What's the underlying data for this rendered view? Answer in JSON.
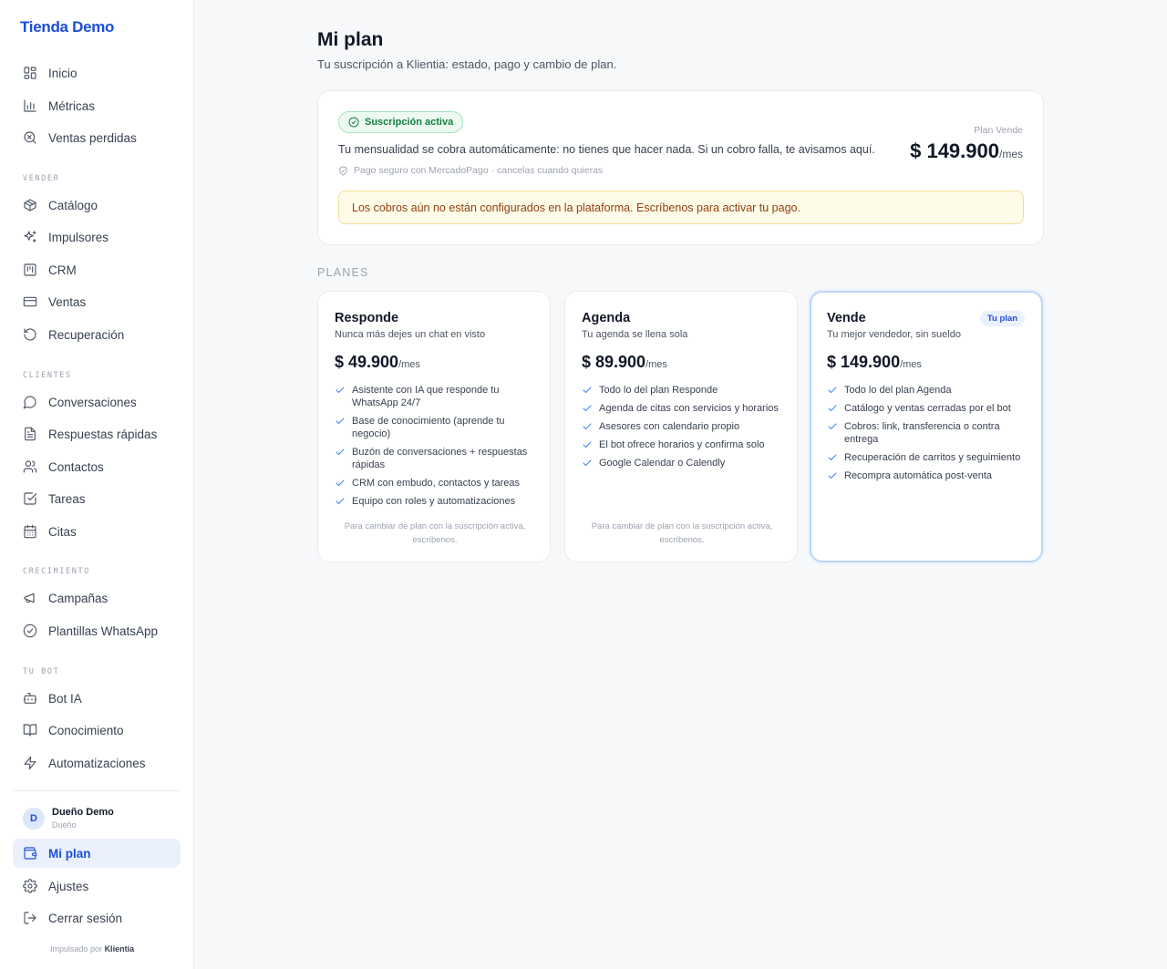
{
  "sidebar": {
    "brand": "Tienda Demo",
    "top_items": [
      {
        "label": "Inicio",
        "icon": "dashboard-icon"
      },
      {
        "label": "Métricas",
        "icon": "bar-chart-icon"
      },
      {
        "label": "Ventas perdidas",
        "icon": "search-x-icon"
      }
    ],
    "sections": [
      {
        "label": "VENDER",
        "items": [
          {
            "label": "Catálogo",
            "icon": "box-icon"
          },
          {
            "label": "Impulsores",
            "icon": "sparkles-icon"
          },
          {
            "label": "CRM",
            "icon": "kanban-icon"
          },
          {
            "label": "Ventas",
            "icon": "credit-card-icon"
          },
          {
            "label": "Recuperación",
            "icon": "rotate-ccw-icon"
          }
        ]
      },
      {
        "label": "CLIENTES",
        "items": [
          {
            "label": "Conversaciones",
            "icon": "chat-bubble-icon"
          },
          {
            "label": "Respuestas rápidas",
            "icon": "file-text-icon"
          },
          {
            "label": "Contactos",
            "icon": "users-icon"
          },
          {
            "label": "Tareas",
            "icon": "check-square-icon"
          },
          {
            "label": "Citas",
            "icon": "calendar-icon"
          }
        ]
      },
      {
        "label": "CRECIMIENTO",
        "items": [
          {
            "label": "Campañas",
            "icon": "megaphone-icon"
          },
          {
            "label": "Plantillas WhatsApp",
            "icon": "check-circle-icon"
          }
        ]
      },
      {
        "label": "TU BOT",
        "items": [
          {
            "label": "Bot IA",
            "icon": "bot-icon"
          },
          {
            "label": "Conocimiento",
            "icon": "book-open-icon"
          },
          {
            "label": "Automatizaciones",
            "icon": "zap-icon"
          }
        ]
      }
    ],
    "user": {
      "initial": "D",
      "name": "Dueño Demo",
      "role": "Dueño"
    },
    "bottom_items": [
      {
        "label": "Mi plan",
        "icon": "wallet-icon",
        "active": true
      },
      {
        "label": "Ajustes",
        "icon": "gear-icon"
      },
      {
        "label": "Cerrar sesión",
        "icon": "logout-icon"
      }
    ],
    "powered_by_prefix": "Impulsado por",
    "powered_by_brand": "Klientia"
  },
  "page": {
    "title": "Mi plan",
    "subtitle": "Tu suscripción a Klientia: estado, pago y cambio de plan."
  },
  "subscription": {
    "status_badge": "Suscripción activa",
    "description": "Tu mensualidad se cobra automáticamente: no tienes que hacer nada. Si un cobro falla, te avisamos aquí.",
    "secure_note": "Pago seguro con MercadoPago · cancelas cuando quieras",
    "plan_label": "Plan Vende",
    "price": "$ 149.900",
    "period": "/mes",
    "warning": "Los cobros aún no están configurados en la plataforma. Escríbenos para activar tu pago."
  },
  "plans_heading": "PLANES",
  "plans": [
    {
      "name": "Responde",
      "tagline": "Nunca más dejes un chat en visto",
      "price": "$ 49.900",
      "period": "/mes",
      "current": false,
      "features": [
        "Asistente con IA que responde tu WhatsApp 24/7",
        "Base de conocimiento (aprende tu negocio)",
        "Buzón de conversaciones + respuestas rápidas",
        "CRM con embudo, contactos y tareas",
        "Equipo con roles y automatizaciones"
      ],
      "note": "Para cambiar de plan con la suscripción activa, escríbenos."
    },
    {
      "name": "Agenda",
      "tagline": "Tu agenda se llena sola",
      "price": "$ 89.900",
      "period": "/mes",
      "current": false,
      "features": [
        "Todo lo del plan Responde",
        "Agenda de citas con servicios y horarios",
        "Asesores con calendario propio",
        "El bot ofrece horarios y confirma solo",
        "Google Calendar o Calendly"
      ],
      "note": "Para cambiar de plan con la suscripción activa, escríbenos."
    },
    {
      "name": "Vende",
      "tagline": "Tu mejor vendedor, sin sueldo",
      "price": "$ 149.900",
      "period": "/mes",
      "current": true,
      "badge": "Tu plan",
      "features": [
        "Todo lo del plan Agenda",
        "Catálogo y ventas cerradas por el bot",
        "Cobros: link, transferencia o contra entrega",
        "Recuperación de carritos y seguimiento",
        "Recompra automática post-venta"
      ],
      "note": ""
    }
  ]
}
